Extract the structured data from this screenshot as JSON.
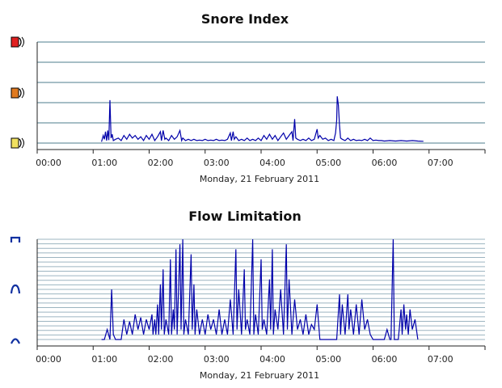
{
  "chart_data": [
    {
      "type": "line",
      "title": "Snore Index",
      "xlabel": "Monday, 21 February 2011",
      "x_ticks": [
        "00:00",
        "01:00",
        "02:00",
        "03:00",
        "04:00",
        "05:00",
        "06:00",
        "07:00"
      ],
      "xlim_hours": [
        0,
        8
      ],
      "ylim": [
        0,
        4
      ],
      "y_levels": [
        "red-snore-icon",
        "orange-snore-icon",
        "yellow-snore-icon"
      ],
      "grid": true,
      "series": [
        {
          "color": "#0000aa",
          "points": [
            [
              1.15,
              0.05
            ],
            [
              1.18,
              0.3
            ],
            [
              1.2,
              0.15
            ],
            [
              1.22,
              0.45
            ],
            [
              1.24,
              0.1
            ],
            [
              1.26,
              0.5
            ],
            [
              1.28,
              0.12
            ],
            [
              1.3,
              1.7
            ],
            [
              1.32,
              0.2
            ],
            [
              1.34,
              0.35
            ],
            [
              1.36,
              0.1
            ],
            [
              1.4,
              0.15
            ],
            [
              1.45,
              0.2
            ],
            [
              1.5,
              0.1
            ],
            [
              1.55,
              0.3
            ],
            [
              1.6,
              0.15
            ],
            [
              1.65,
              0.35
            ],
            [
              1.7,
              0.2
            ],
            [
              1.75,
              0.3
            ],
            [
              1.8,
              0.15
            ],
            [
              1.85,
              0.25
            ],
            [
              1.9,
              0.1
            ],
            [
              1.95,
              0.3
            ],
            [
              2.0,
              0.15
            ],
            [
              2.05,
              0.35
            ],
            [
              2.1,
              0.1
            ],
            [
              2.15,
              0.25
            ],
            [
              2.2,
              0.45
            ],
            [
              2.22,
              0.1
            ],
            [
              2.25,
              0.5
            ],
            [
              2.28,
              0.15
            ],
            [
              2.3,
              0.2
            ],
            [
              2.35,
              0.1
            ],
            [
              2.4,
              0.3
            ],
            [
              2.45,
              0.15
            ],
            [
              2.5,
              0.25
            ],
            [
              2.55,
              0.5
            ],
            [
              2.58,
              0.1
            ],
            [
              2.6,
              0.2
            ],
            [
              2.65,
              0.1
            ],
            [
              2.7,
              0.15
            ],
            [
              2.75,
              0.1
            ],
            [
              2.8,
              0.15
            ],
            [
              2.85,
              0.1
            ],
            [
              2.9,
              0.12
            ],
            [
              2.95,
              0.1
            ],
            [
              3.0,
              0.15
            ],
            [
              3.05,
              0.1
            ],
            [
              3.1,
              0.12
            ],
            [
              3.15,
              0.1
            ],
            [
              3.2,
              0.15
            ],
            [
              3.25,
              0.1
            ],
            [
              3.3,
              0.12
            ],
            [
              3.35,
              0.1
            ],
            [
              3.4,
              0.15
            ],
            [
              3.45,
              0.4
            ],
            [
              3.47,
              0.1
            ],
            [
              3.5,
              0.45
            ],
            [
              3.52,
              0.15
            ],
            [
              3.55,
              0.25
            ],
            [
              3.6,
              0.1
            ],
            [
              3.65,
              0.15
            ],
            [
              3.7,
              0.1
            ],
            [
              3.75,
              0.2
            ],
            [
              3.8,
              0.1
            ],
            [
              3.85,
              0.15
            ],
            [
              3.9,
              0.1
            ],
            [
              3.95,
              0.2
            ],
            [
              4.0,
              0.1
            ],
            [
              4.05,
              0.3
            ],
            [
              4.1,
              0.15
            ],
            [
              4.15,
              0.35
            ],
            [
              4.2,
              0.15
            ],
            [
              4.25,
              0.3
            ],
            [
              4.3,
              0.1
            ],
            [
              4.35,
              0.25
            ],
            [
              4.4,
              0.4
            ],
            [
              4.45,
              0.15
            ],
            [
              4.5,
              0.3
            ],
            [
              4.55,
              0.45
            ],
            [
              4.57,
              0.1
            ],
            [
              4.6,
              0.95
            ],
            [
              4.62,
              0.2
            ],
            [
              4.65,
              0.15
            ],
            [
              4.7,
              0.1
            ],
            [
              4.75,
              0.15
            ],
            [
              4.8,
              0.1
            ],
            [
              4.85,
              0.2
            ],
            [
              4.9,
              0.1
            ],
            [
              4.95,
              0.15
            ],
            [
              5.0,
              0.55
            ],
            [
              5.02,
              0.2
            ],
            [
              5.05,
              0.3
            ],
            [
              5.1,
              0.15
            ],
            [
              5.15,
              0.2
            ],
            [
              5.2,
              0.1
            ],
            [
              5.25,
              0.15
            ],
            [
              5.3,
              0.1
            ],
            [
              5.33,
              0.4
            ],
            [
              5.35,
              0.9
            ],
            [
              5.36,
              1.85
            ],
            [
              5.38,
              1.5
            ],
            [
              5.4,
              0.7
            ],
            [
              5.42,
              0.2
            ],
            [
              5.45,
              0.15
            ],
            [
              5.5,
              0.1
            ],
            [
              5.55,
              0.2
            ],
            [
              5.6,
              0.1
            ],
            [
              5.65,
              0.15
            ],
            [
              5.7,
              0.1
            ],
            [
              5.75,
              0.12
            ],
            [
              5.8,
              0.1
            ],
            [
              5.85,
              0.15
            ],
            [
              5.9,
              0.1
            ],
            [
              5.95,
              0.2
            ],
            [
              6.0,
              0.1
            ],
            [
              6.05,
              0.12
            ],
            [
              6.1,
              0.1
            ],
            [
              6.15,
              0.1
            ],
            [
              6.2,
              0.08
            ],
            [
              6.3,
              0.1
            ],
            [
              6.4,
              0.08
            ],
            [
              6.5,
              0.1
            ],
            [
              6.6,
              0.08
            ],
            [
              6.7,
              0.1
            ],
            [
              6.8,
              0.08
            ],
            [
              6.9,
              0.07
            ]
          ]
        }
      ]
    },
    {
      "type": "line",
      "title": "Flow Limitation",
      "xlabel": "Monday, 21 February 2011",
      "x_ticks": [
        "00:00",
        "01:00",
        "02:00",
        "03:00",
        "04:00",
        "05:00",
        "06:00",
        "07:00"
      ],
      "xlim_hours": [
        0,
        8
      ],
      "ylim": [
        0,
        1
      ],
      "y_levels": [
        "flow-full-icon",
        "flow-partial-icon",
        "flow-normal-icon"
      ],
      "grid": true,
      "series": [
        {
          "color": "#0000aa",
          "points": [
            [
              1.15,
              0.0
            ],
            [
              1.2,
              0.0
            ],
            [
              1.25,
              0.1
            ],
            [
              1.3,
              0.0
            ],
            [
              1.33,
              0.5
            ],
            [
              1.36,
              0.05
            ],
            [
              1.4,
              0.0
            ],
            [
              1.5,
              0.0
            ],
            [
              1.55,
              0.2
            ],
            [
              1.6,
              0.05
            ],
            [
              1.65,
              0.18
            ],
            [
              1.7,
              0.05
            ],
            [
              1.75,
              0.25
            ],
            [
              1.8,
              0.1
            ],
            [
              1.85,
              0.22
            ],
            [
              1.9,
              0.05
            ],
            [
              1.95,
              0.2
            ],
            [
              2.0,
              0.1
            ],
            [
              2.05,
              0.25
            ],
            [
              2.07,
              0.05
            ],
            [
              2.1,
              0.2
            ],
            [
              2.12,
              0.05
            ],
            [
              2.15,
              0.35
            ],
            [
              2.17,
              0.05
            ],
            [
              2.2,
              0.55
            ],
            [
              2.22,
              0.1
            ],
            [
              2.25,
              0.7
            ],
            [
              2.27,
              0.05
            ],
            [
              2.3,
              0.2
            ],
            [
              2.35,
              0.05
            ],
            [
              2.38,
              0.8
            ],
            [
              2.4,
              0.05
            ],
            [
              2.43,
              0.3
            ],
            [
              2.45,
              0.1
            ],
            [
              2.48,
              0.9
            ],
            [
              2.5,
              0.05
            ],
            [
              2.55,
              0.95
            ],
            [
              2.57,
              0.1
            ],
            [
              2.6,
              1.0
            ],
            [
              2.62,
              0.05
            ],
            [
              2.65,
              0.2
            ],
            [
              2.7,
              0.05
            ],
            [
              2.75,
              0.85
            ],
            [
              2.77,
              0.1
            ],
            [
              2.8,
              0.55
            ],
            [
              2.82,
              0.05
            ],
            [
              2.85,
              0.3
            ],
            [
              2.9,
              0.05
            ],
            [
              2.95,
              0.2
            ],
            [
              3.0,
              0.05
            ],
            [
              3.05,
              0.25
            ],
            [
              3.1,
              0.1
            ],
            [
              3.15,
              0.2
            ],
            [
              3.2,
              0.05
            ],
            [
              3.25,
              0.3
            ],
            [
              3.3,
              0.05
            ],
            [
              3.35,
              0.2
            ],
            [
              3.4,
              0.05
            ],
            [
              3.45,
              0.4
            ],
            [
              3.5,
              0.05
            ],
            [
              3.55,
              0.9
            ],
            [
              3.57,
              0.1
            ],
            [
              3.6,
              0.5
            ],
            [
              3.65,
              0.05
            ],
            [
              3.7,
              0.7
            ],
            [
              3.72,
              0.1
            ],
            [
              3.75,
              0.2
            ],
            [
              3.8,
              0.05
            ],
            [
              3.85,
              1.0
            ],
            [
              3.87,
              0.05
            ],
            [
              3.9,
              0.25
            ],
            [
              3.95,
              0.05
            ],
            [
              4.0,
              0.8
            ],
            [
              4.02,
              0.1
            ],
            [
              4.05,
              0.2
            ],
            [
              4.1,
              0.05
            ],
            [
              4.15,
              0.6
            ],
            [
              4.17,
              0.1
            ],
            [
              4.2,
              0.9
            ],
            [
              4.22,
              0.05
            ],
            [
              4.25,
              0.3
            ],
            [
              4.3,
              0.1
            ],
            [
              4.35,
              0.5
            ],
            [
              4.4,
              0.05
            ],
            [
              4.45,
              0.95
            ],
            [
              4.47,
              0.1
            ],
            [
              4.5,
              0.6
            ],
            [
              4.55,
              0.05
            ],
            [
              4.6,
              0.4
            ],
            [
              4.65,
              0.1
            ],
            [
              4.7,
              0.2
            ],
            [
              4.75,
              0.05
            ],
            [
              4.8,
              0.25
            ],
            [
              4.85,
              0.05
            ],
            [
              4.9,
              0.15
            ],
            [
              4.95,
              0.1
            ],
            [
              5.0,
              0.35
            ],
            [
              5.05,
              0.0
            ],
            [
              5.35,
              0.0
            ],
            [
              5.4,
              0.45
            ],
            [
              5.42,
              0.05
            ],
            [
              5.45,
              0.35
            ],
            [
              5.5,
              0.05
            ],
            [
              5.55,
              0.45
            ],
            [
              5.57,
              0.1
            ],
            [
              5.6,
              0.3
            ],
            [
              5.65,
              0.05
            ],
            [
              5.7,
              0.35
            ],
            [
              5.75,
              0.05
            ],
            [
              5.8,
              0.4
            ],
            [
              5.85,
              0.1
            ],
            [
              5.9,
              0.2
            ],
            [
              5.95,
              0.05
            ],
            [
              6.0,
              0.0
            ],
            [
              6.2,
              0.0
            ],
            [
              6.25,
              0.1
            ],
            [
              6.3,
              0.0
            ],
            [
              6.32,
              0.0
            ],
            [
              6.36,
              1.0
            ],
            [
              6.38,
              0.0
            ],
            [
              6.45,
              0.0
            ],
            [
              6.5,
              0.3
            ],
            [
              6.52,
              0.05
            ],
            [
              6.55,
              0.35
            ],
            [
              6.58,
              0.1
            ],
            [
              6.6,
              0.25
            ],
            [
              6.63,
              0.05
            ],
            [
              6.66,
              0.3
            ],
            [
              6.7,
              0.1
            ],
            [
              6.75,
              0.2
            ],
            [
              6.8,
              0.0
            ]
          ]
        }
      ]
    }
  ]
}
